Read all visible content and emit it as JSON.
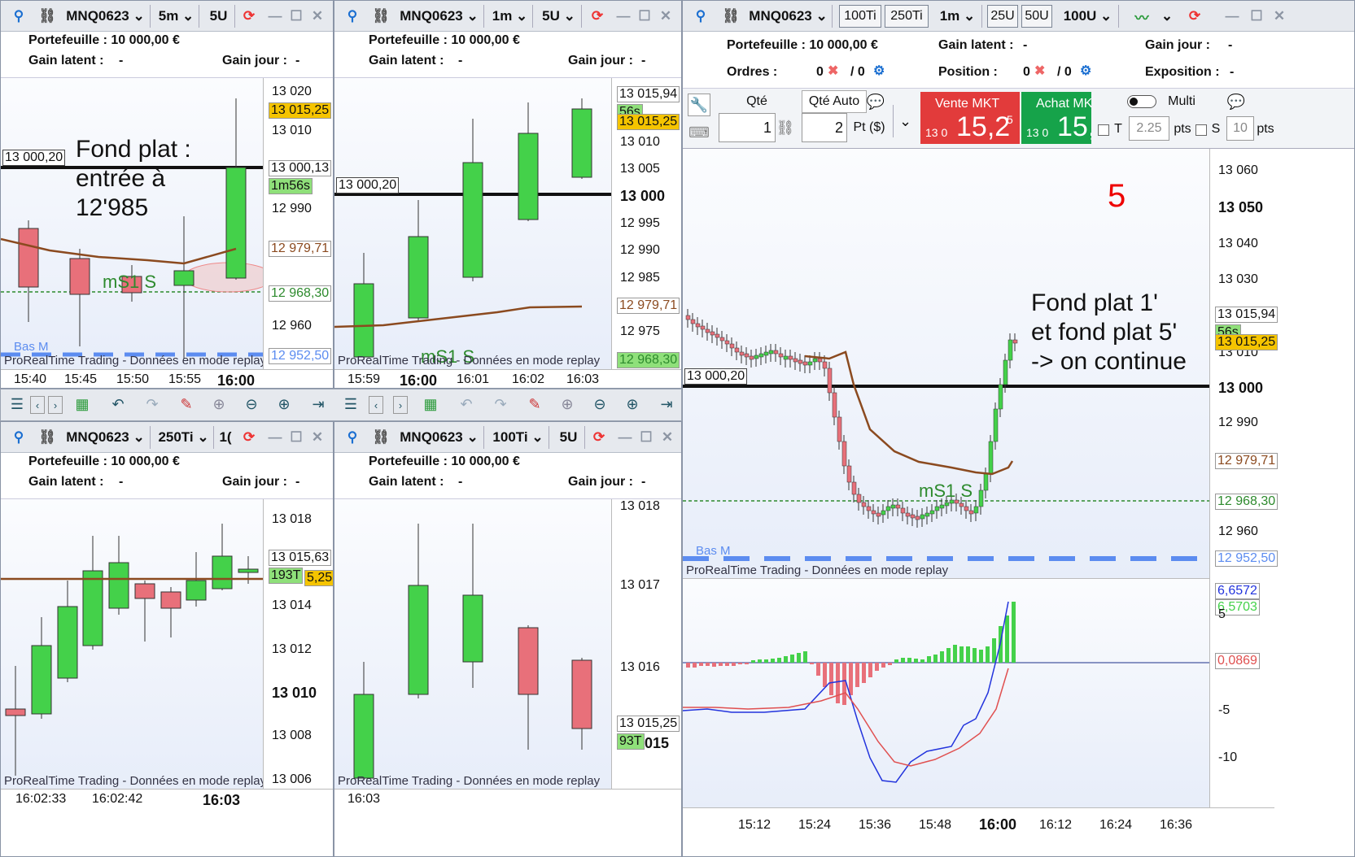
{
  "common": {
    "portfolio": "Portefeuille : 10 000,00 €",
    "latent": "Gain latent :",
    "jour": "Gain jour :",
    "dash": "-",
    "footer": "ProRealTime Trading - Données en mode replay",
    "symbol": "MNQ0623",
    "low_label": "Bas M",
    "ms1": "mS1 S",
    "level_tag": "13 000,20"
  },
  "win1": {
    "timeframe": "5m",
    "units": "5U",
    "prices": [
      "13 020",
      "13 010",
      "12 990",
      "12 960"
    ],
    "tags": [
      "13 015,25",
      "13 000,13",
      "1m56s",
      "12 979,71",
      "12 968,30",
      "12 952,50"
    ],
    "xlabels": [
      "15:40",
      "15:45",
      "15:50",
      "15:55",
      "16:00"
    ],
    "note": [
      "Fond plat :",
      "entrée à",
      "12'985"
    ]
  },
  "win2": {
    "timeframe": "1m",
    "units": "5U",
    "prices": [
      "13 010",
      "13 005",
      "13 000",
      "12 995",
      "12 990",
      "12 985",
      "12 975"
    ],
    "tags": [
      "13 015,94",
      "56s",
      "13 015,25",
      "12 979,71",
      "12 968,30"
    ],
    "xlabels": [
      "15:59",
      "16:00",
      "16:01",
      "16:02",
      "16:03"
    ]
  },
  "win3": {
    "timeframe": "250Ti",
    "units": "1(",
    "prices": [
      "13 018",
      "13 014",
      "13 012",
      "13 010",
      "13 008",
      "13 006"
    ],
    "tags": [
      "13 015,63",
      "193T",
      "5,25"
    ],
    "xlabels": [
      "16:02:33",
      "16:02:42",
      "16:03"
    ]
  },
  "win4": {
    "timeframe": "100Ti",
    "units": "5U",
    "prices": [
      "13 018",
      "13 017",
      "13 016"
    ],
    "tags": [
      "13 015,25",
      "93T",
      "015"
    ],
    "xlabels": [
      "16:03"
    ]
  },
  "win5": {
    "btns": [
      "100Ti",
      "250Ti",
      "1m",
      "25U",
      "50U",
      "100U"
    ],
    "orders": "Ordres :",
    "position": "Position :",
    "exposition": "Exposition :",
    "zero": "0",
    "slash0": "/ 0",
    "qty_label": "Qté",
    "qty_auto": "Qté Auto",
    "qty": "1",
    "auto_val": "2",
    "pt_unit": "Pt ($)",
    "sell_label": "Vente MKT",
    "buy_label": "Achat MK",
    "price_small": "13 0",
    "price_big": "15,2",
    "price_sup": "5",
    "buy_big": "15,",
    "multi": "Multi",
    "t_label": "T",
    "t_val": "2.25",
    "pts": "pts",
    "s_label": "S",
    "s_val": "10",
    "count": "5",
    "note": [
      "Fond plat 1'",
      "et fond plat 5'",
      " -> on continue"
    ],
    "prices": [
      "13 060",
      "13 050",
      "13 040",
      "13 030",
      "13 010",
      "13 000",
      "12 990",
      "12 960"
    ],
    "tags": [
      "13 015,94",
      "56s",
      "13 015,25",
      "12 979,71",
      "12 968,30",
      "12 952,50"
    ],
    "ind_tags": [
      "6,6572",
      "6,5703",
      "0,0869"
    ],
    "ind_labels": [
      "5",
      "-5",
      "-10"
    ],
    "xlabels": [
      "15:12",
      "15:24",
      "15:36",
      "15:48",
      "16:00",
      "16:12",
      "16:24",
      "16:36"
    ]
  },
  "colors": {
    "up": "#44d14a",
    "down": "#e8707a",
    "ema": "#8b4a1f",
    "level": "#111111",
    "support": "#2d8a2d",
    "low": "#5c8cf0",
    "tag_price": "#f5c400",
    "tag_time": "#8fe07a"
  }
}
